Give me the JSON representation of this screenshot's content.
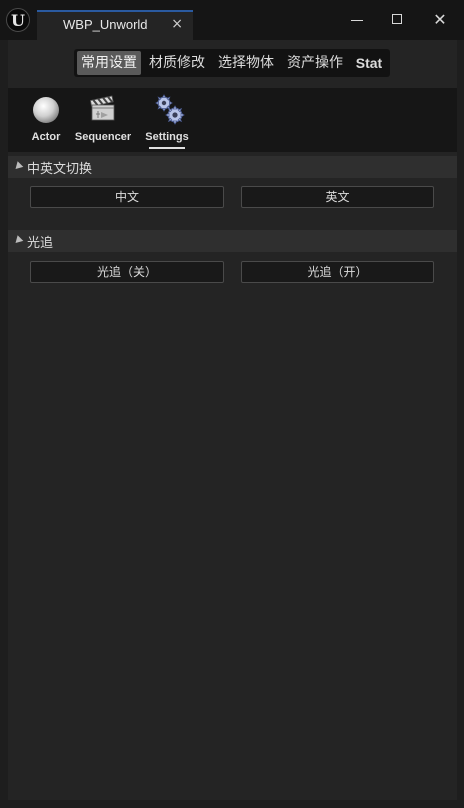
{
  "window": {
    "logo": "U",
    "tab_title": "WBP_Unworld",
    "tab_close": "×",
    "close_glyph": "✕"
  },
  "categories": [
    {
      "label": "常用设置",
      "active": true
    },
    {
      "label": "材质修改",
      "active": false
    },
    {
      "label": "选择物体",
      "active": false
    },
    {
      "label": "资产操作",
      "active": false
    },
    {
      "label": "Stat",
      "active": false
    }
  ],
  "toolbar": {
    "items": [
      {
        "label": "Actor",
        "icon": "sphere-icon"
      },
      {
        "label": "Sequencer",
        "icon": "clapperboard-icon"
      },
      {
        "label": "Settings",
        "icon": "gears-icon",
        "selected": true
      }
    ]
  },
  "sections": [
    {
      "title": "中英文切换",
      "buttons": [
        "中文",
        "英文"
      ]
    },
    {
      "title": "光追",
      "buttons": [
        "光追（关）",
        "光追（开）"
      ]
    }
  ]
}
